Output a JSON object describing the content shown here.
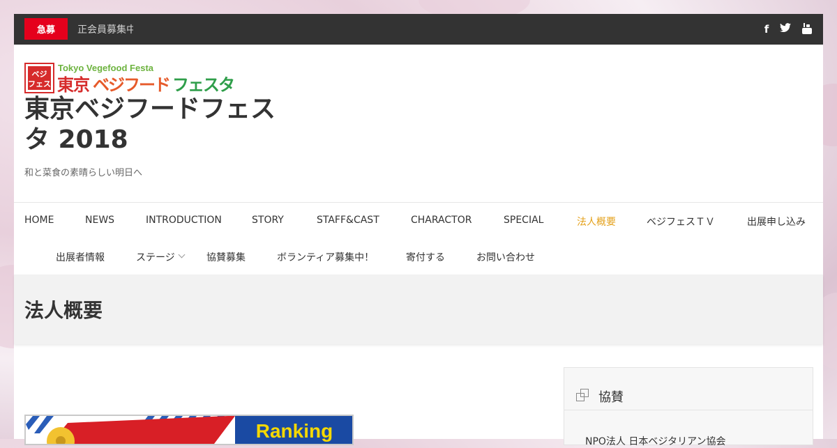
{
  "topbar": {
    "badge_label": "急募",
    "ticker_text": "正会員募集中",
    "social": [
      {
        "icon": "facebook-icon",
        "glyph": "f"
      },
      {
        "icon": "twitter-icon",
        "glyph": "t"
      },
      {
        "icon": "youtube-icon",
        "glyph": "▶"
      }
    ]
  },
  "branding": {
    "logo_en": "Tokyo Vegefood Festa",
    "logo_jp": "東京ベジフードフェスタ",
    "logo_mark": "ベジフェス",
    "site_title": "東京ベジフードフェスタ 2018",
    "tagline": "和と菜食の素晴らしい明日へ"
  },
  "nav": {
    "row1": [
      "HOME",
      "NEWS",
      "INTRODUCTION",
      "STORY",
      "STAFF&CAST",
      "CHARACTOR",
      "SPECIAL",
      "法人概要",
      "ベジフェスＴＶ",
      "出展申し込み"
    ],
    "row2": [
      "出展者情報",
      "ステージ",
      "協賛募集",
      "ボランティア募集中！",
      "寄付する",
      "お問い合わせ"
    ],
    "active": "法人概要"
  },
  "page": {
    "title": "法人概要"
  },
  "banner": {
    "text": "Ranking"
  },
  "sidebar": {
    "widget_title": "協賛",
    "widget_icon": "widget-squares-icon",
    "first_item": "NPO法人 日本ベジタリアン協会"
  },
  "colors": {
    "accent": "#e4a11b",
    "badge": "#e5001c",
    "topbar": "#333333"
  }
}
